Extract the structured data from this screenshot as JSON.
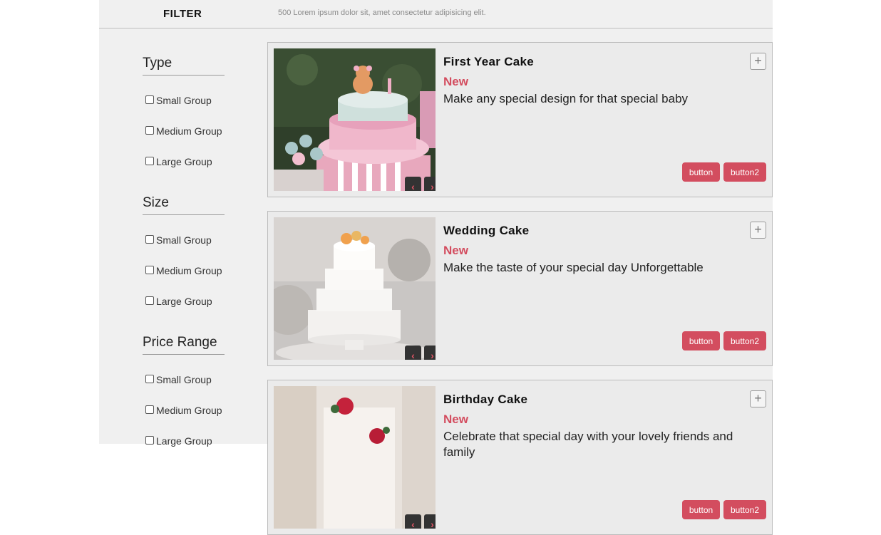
{
  "header": {
    "filter_label": "FILTER",
    "result_text": "500 Lorem ipsum dolor sit, amet consectetur adipisicing elit."
  },
  "filters": [
    {
      "title": "Type",
      "options": [
        "Small Group",
        "Medium Group",
        "Large Group"
      ]
    },
    {
      "title": "Size",
      "options": [
        "Small Group",
        "Medium Group",
        "Large Group"
      ]
    },
    {
      "title": "Price Range",
      "options": [
        "Small Group",
        "Medium Group",
        "Large Group"
      ]
    }
  ],
  "cards": [
    {
      "title": "First Year Cake",
      "badge": "New",
      "description": "Make any special design for that special baby",
      "button1": "button",
      "button2": "button2",
      "image": "baby-cake-photo"
    },
    {
      "title": "Wedding Cake",
      "badge": "New",
      "description": "Make the taste of your special day Unforgettable",
      "button1": "button",
      "button2": "button2",
      "image": "wedding-cake-photo"
    },
    {
      "title": "Birthday Cake",
      "badge": "New",
      "description": "Celebrate that special day with your lovely friends and family",
      "button1": "button",
      "button2": "button2",
      "image": "birthday-cake-photo"
    }
  ],
  "icons": {
    "prev": "‹",
    "next": "›",
    "add": "+"
  },
  "colors": {
    "accent": "#d34d5f",
    "panel": "#f0f0f0",
    "card": "#ebebeb"
  }
}
